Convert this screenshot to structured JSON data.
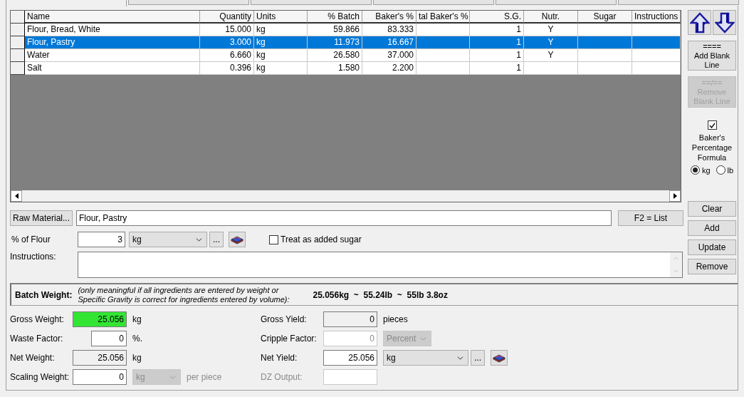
{
  "tabs": [
    {
      "selected": true
    },
    {
      "selected": false
    },
    {
      "selected": false
    },
    {
      "selected": false
    },
    {
      "selected": false
    },
    {
      "selected": false
    }
  ],
  "grid": {
    "columns": [
      "Name",
      "Quantity",
      "Units",
      "% Batch",
      "Baker's %",
      "tal Baker's %",
      "S.G.",
      "Nutr.",
      "Sugar",
      "Instructions"
    ],
    "rows": [
      {
        "selected": false,
        "cells": [
          "Flour, Bread, White",
          "15.000",
          "kg",
          "59.866",
          "83.333",
          "",
          "1",
          "Y",
          "",
          ""
        ]
      },
      {
        "selected": true,
        "cells": [
          "Flour, Pastry",
          "3.000",
          "kg",
          "11.973",
          "16.667",
          "",
          "1",
          "Y",
          "",
          ""
        ]
      },
      {
        "selected": false,
        "cells": [
          "Water",
          "6.660",
          "kg",
          "26.580",
          "37.000",
          "",
          "1",
          "Y",
          "",
          ""
        ]
      },
      {
        "selected": false,
        "cells": [
          "Salt",
          "0.396",
          "kg",
          "1.580",
          "2.200",
          "",
          "1",
          "",
          ""
        ]
      }
    ]
  },
  "side": {
    "add_blank_line": {
      "symbol": "====",
      "label": "Add Blank Line",
      "disabled": false
    },
    "remove_blank_line": {
      "symbol": "==/==",
      "label": "Remove Blank Line",
      "disabled": true
    },
    "bakers_percentage": {
      "label": "Baker's Percentage Formula",
      "checked": true
    },
    "units": [
      {
        "label": "kg",
        "selected": true
      },
      {
        "label": "lb",
        "selected": false
      }
    ],
    "buttons": [
      "Clear",
      "Add",
      "Update",
      "Remove"
    ]
  },
  "ingredient": {
    "raw_material_button": "Raw Material...",
    "raw_material": "Flour, Pastry",
    "list_button": "F2 = List",
    "percent_label": "% of Flour",
    "percent_value": "3",
    "percent_unit": "kg",
    "browse_button": "...",
    "sugar": {
      "label": "Treat as added sugar",
      "checked": false
    },
    "instructions_label": "Instructions:"
  },
  "batch_weight": {
    "label": "Batch Weight:",
    "note": "(only meaningful if all ingredients are entered by weight or Specific Gravity is correct for ingredients entered by volume):",
    "value": "25.056kg  ~  55.24lb  ~  55lb 3.8oz"
  },
  "weights": {
    "gross_weight": {
      "label": "Gross Weight:",
      "value": "25.056",
      "unit": "kg"
    },
    "waste_factor": {
      "label": "Waste Factor:",
      "value": "0",
      "unit": "%."
    },
    "net_weight": {
      "label": "Net Weight:",
      "value": "25.056",
      "unit": "kg"
    },
    "scaling_weight": {
      "label": "Scaling Weight:",
      "value": "0",
      "unit": "kg",
      "suffix": "per piece"
    }
  },
  "yields": {
    "gross_yield": {
      "label": "Gross Yield:",
      "value": "0",
      "unit": "pieces"
    },
    "cripple_factor": {
      "label": "Cripple Factor:",
      "value": "0",
      "unit": "Percent",
      "disabled": true
    },
    "net_yield": {
      "label": "Net Yield:",
      "value": "25.056",
      "unit": "kg",
      "browse_button": "..."
    },
    "dz_output": {
      "label": "DZ Output:",
      "disabled": true
    }
  }
}
